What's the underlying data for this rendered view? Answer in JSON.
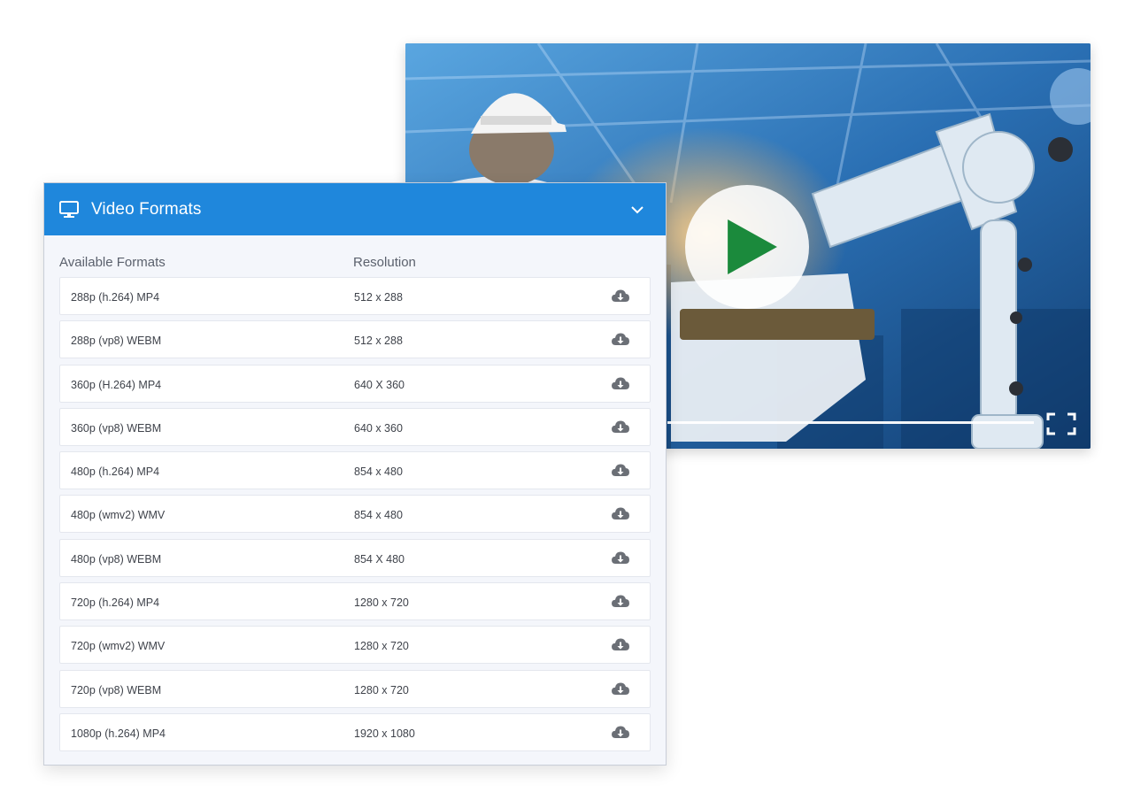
{
  "player": {
    "play_icon_color": "#1b8a3c",
    "play_icon": "play-icon",
    "fullscreen_icon": "fullscreen-icon"
  },
  "panel": {
    "title": "Video Formats",
    "header_color": "#1f87dc",
    "header_icon": "monitor-icon",
    "collapse_icon": "chevron-down-icon",
    "columns": {
      "formats": "Available Formats",
      "resolution": "Resolution"
    },
    "download_icon": "cloud-download-icon",
    "rows": [
      {
        "format": "288p (h.264) MP4",
        "resolution": "512 x 288"
      },
      {
        "format": "288p (vp8) WEBM",
        "resolution": "512 x 288"
      },
      {
        "format": "360p (H.264) MP4",
        "resolution": "640 X 360"
      },
      {
        "format": "360p (vp8) WEBM",
        "resolution": "640 x 360"
      },
      {
        "format": "480p (h.264) MP4",
        "resolution": "854 x 480"
      },
      {
        "format": "480p (wmv2) WMV",
        "resolution": "854 x 480"
      },
      {
        "format": "480p (vp8) WEBM",
        "resolution": "854 X 480"
      },
      {
        "format": "720p (h.264) MP4",
        "resolution": "1280 x 720"
      },
      {
        "format": "720p (wmv2) WMV",
        "resolution": "1280 x 720"
      },
      {
        "format": "720p (vp8) WEBM",
        "resolution": "1280 x 720"
      },
      {
        "format": "1080p (h.264) MP4",
        "resolution": "1920 x 1080"
      }
    ]
  }
}
